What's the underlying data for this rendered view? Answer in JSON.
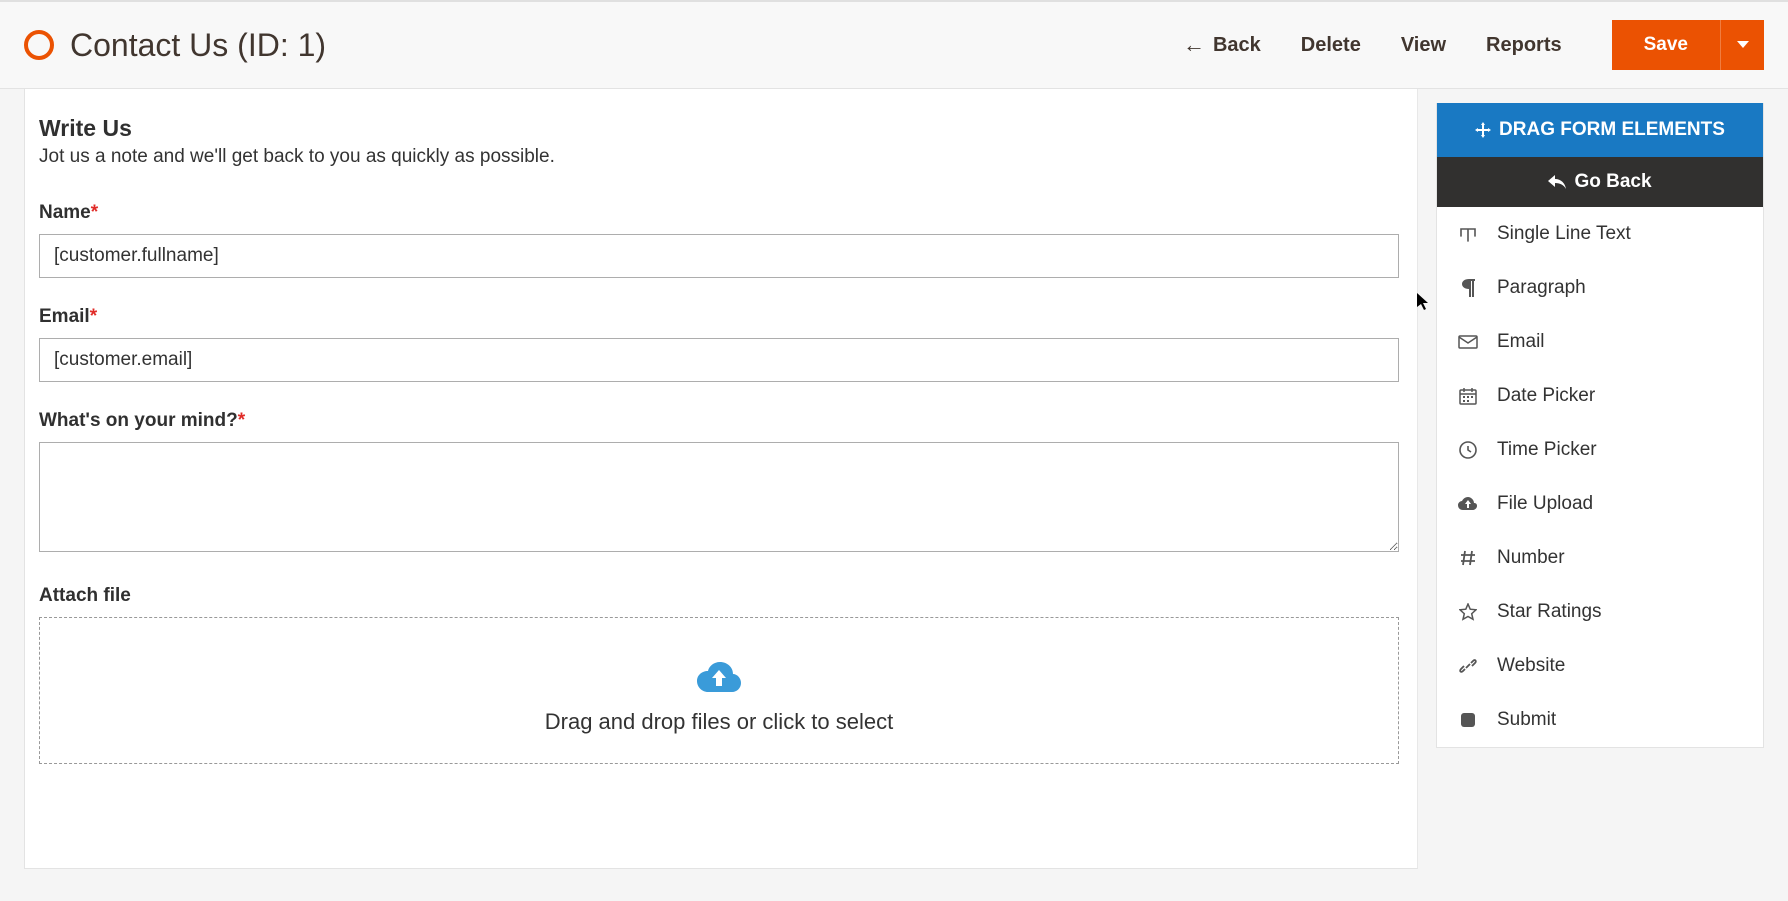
{
  "pageTitle": "Contact Us (ID: 1)",
  "header": {
    "back": "Back",
    "delete": "Delete",
    "view": "View",
    "reports": "Reports",
    "save": "Save"
  },
  "form": {
    "title": "Write Us",
    "subtitle": "Jot us a note and we'll get back to you as quickly as possible.",
    "fields": {
      "name": {
        "label": "Name",
        "value": "[customer.fullname]",
        "required": true
      },
      "email": {
        "label": "Email",
        "value": "[customer.email]",
        "required": true
      },
      "mind": {
        "label": "What's on your mind?",
        "value": "",
        "required": true
      },
      "attach": {
        "label": "Attach file"
      }
    },
    "dropzone": "Drag and drop files or click to select"
  },
  "sidebar": {
    "header": "DRAG FORM ELEMENTS",
    "goBack": "Go Back",
    "items": [
      "Single Line Text",
      "Paragraph",
      "Email",
      "Date Picker",
      "Time Picker",
      "File Upload",
      "Number",
      "Star Ratings",
      "Website",
      "Submit"
    ]
  }
}
